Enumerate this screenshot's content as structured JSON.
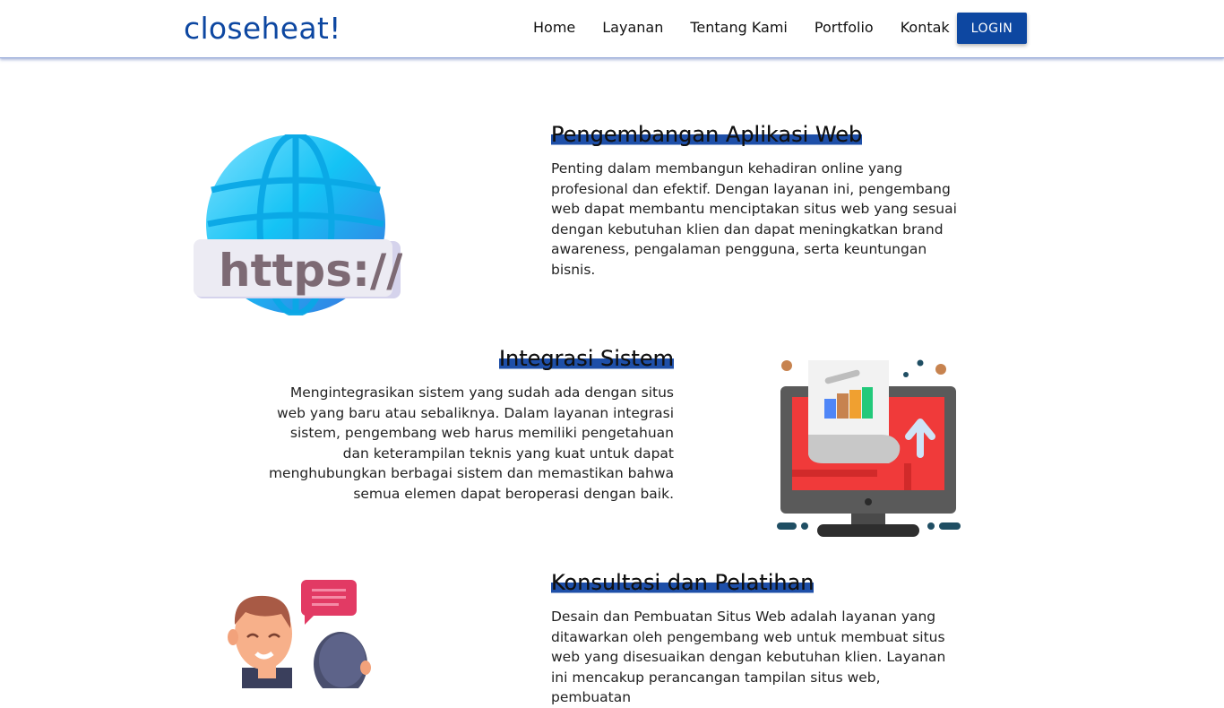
{
  "brand": "closeheat!",
  "nav": {
    "items": [
      "Home",
      "Layanan",
      "Tentang Kami",
      "Portfolio",
      "Kontak"
    ],
    "login_label": "LOGIN"
  },
  "services": [
    {
      "title": "Pengembangan Aplikasi Web",
      "description": "Penting dalam membangun kehadiran online yang profesional dan efektif. Dengan layanan ini, pengembang web dapat membantu menciptakan situs web yang sesuai dengan kebutuhan klien dan dapat meningkatkan brand awareness, pengalaman pengguna, serta keuntungan bisnis.",
      "illustration_text": "https://",
      "icon": "globe-https-icon"
    },
    {
      "title": "Integrasi Sistem",
      "description": "Mengintegrasikan sistem yang sudah ada dengan situs web yang baru atau sebaliknya. Dalam layanan integrasi sistem, pengembang web harus memiliki pengetahuan dan keterampilan teknis yang kuat untuk dapat menghubungkan berbagai sistem dan memastikan bahwa semua elemen dapat beroperasi dengan baik.",
      "icon": "monitor-report-icon"
    },
    {
      "title": "Konsultasi dan Pelatihan",
      "description": "Desain dan Pembuatan Situs Web adalah layanan yang ditawarkan oleh pengembang web untuk membuat situs web yang disesuaikan dengan kebutuhan klien. Layanan ini mencakup perancangan tampilan situs web, pembuatan",
      "icon": "consultation-people-icon"
    }
  ],
  "colors": {
    "brand": "#0d47a1",
    "heading_highlight": "#1e4fa8",
    "monitor_screen": "#f03a3a"
  }
}
